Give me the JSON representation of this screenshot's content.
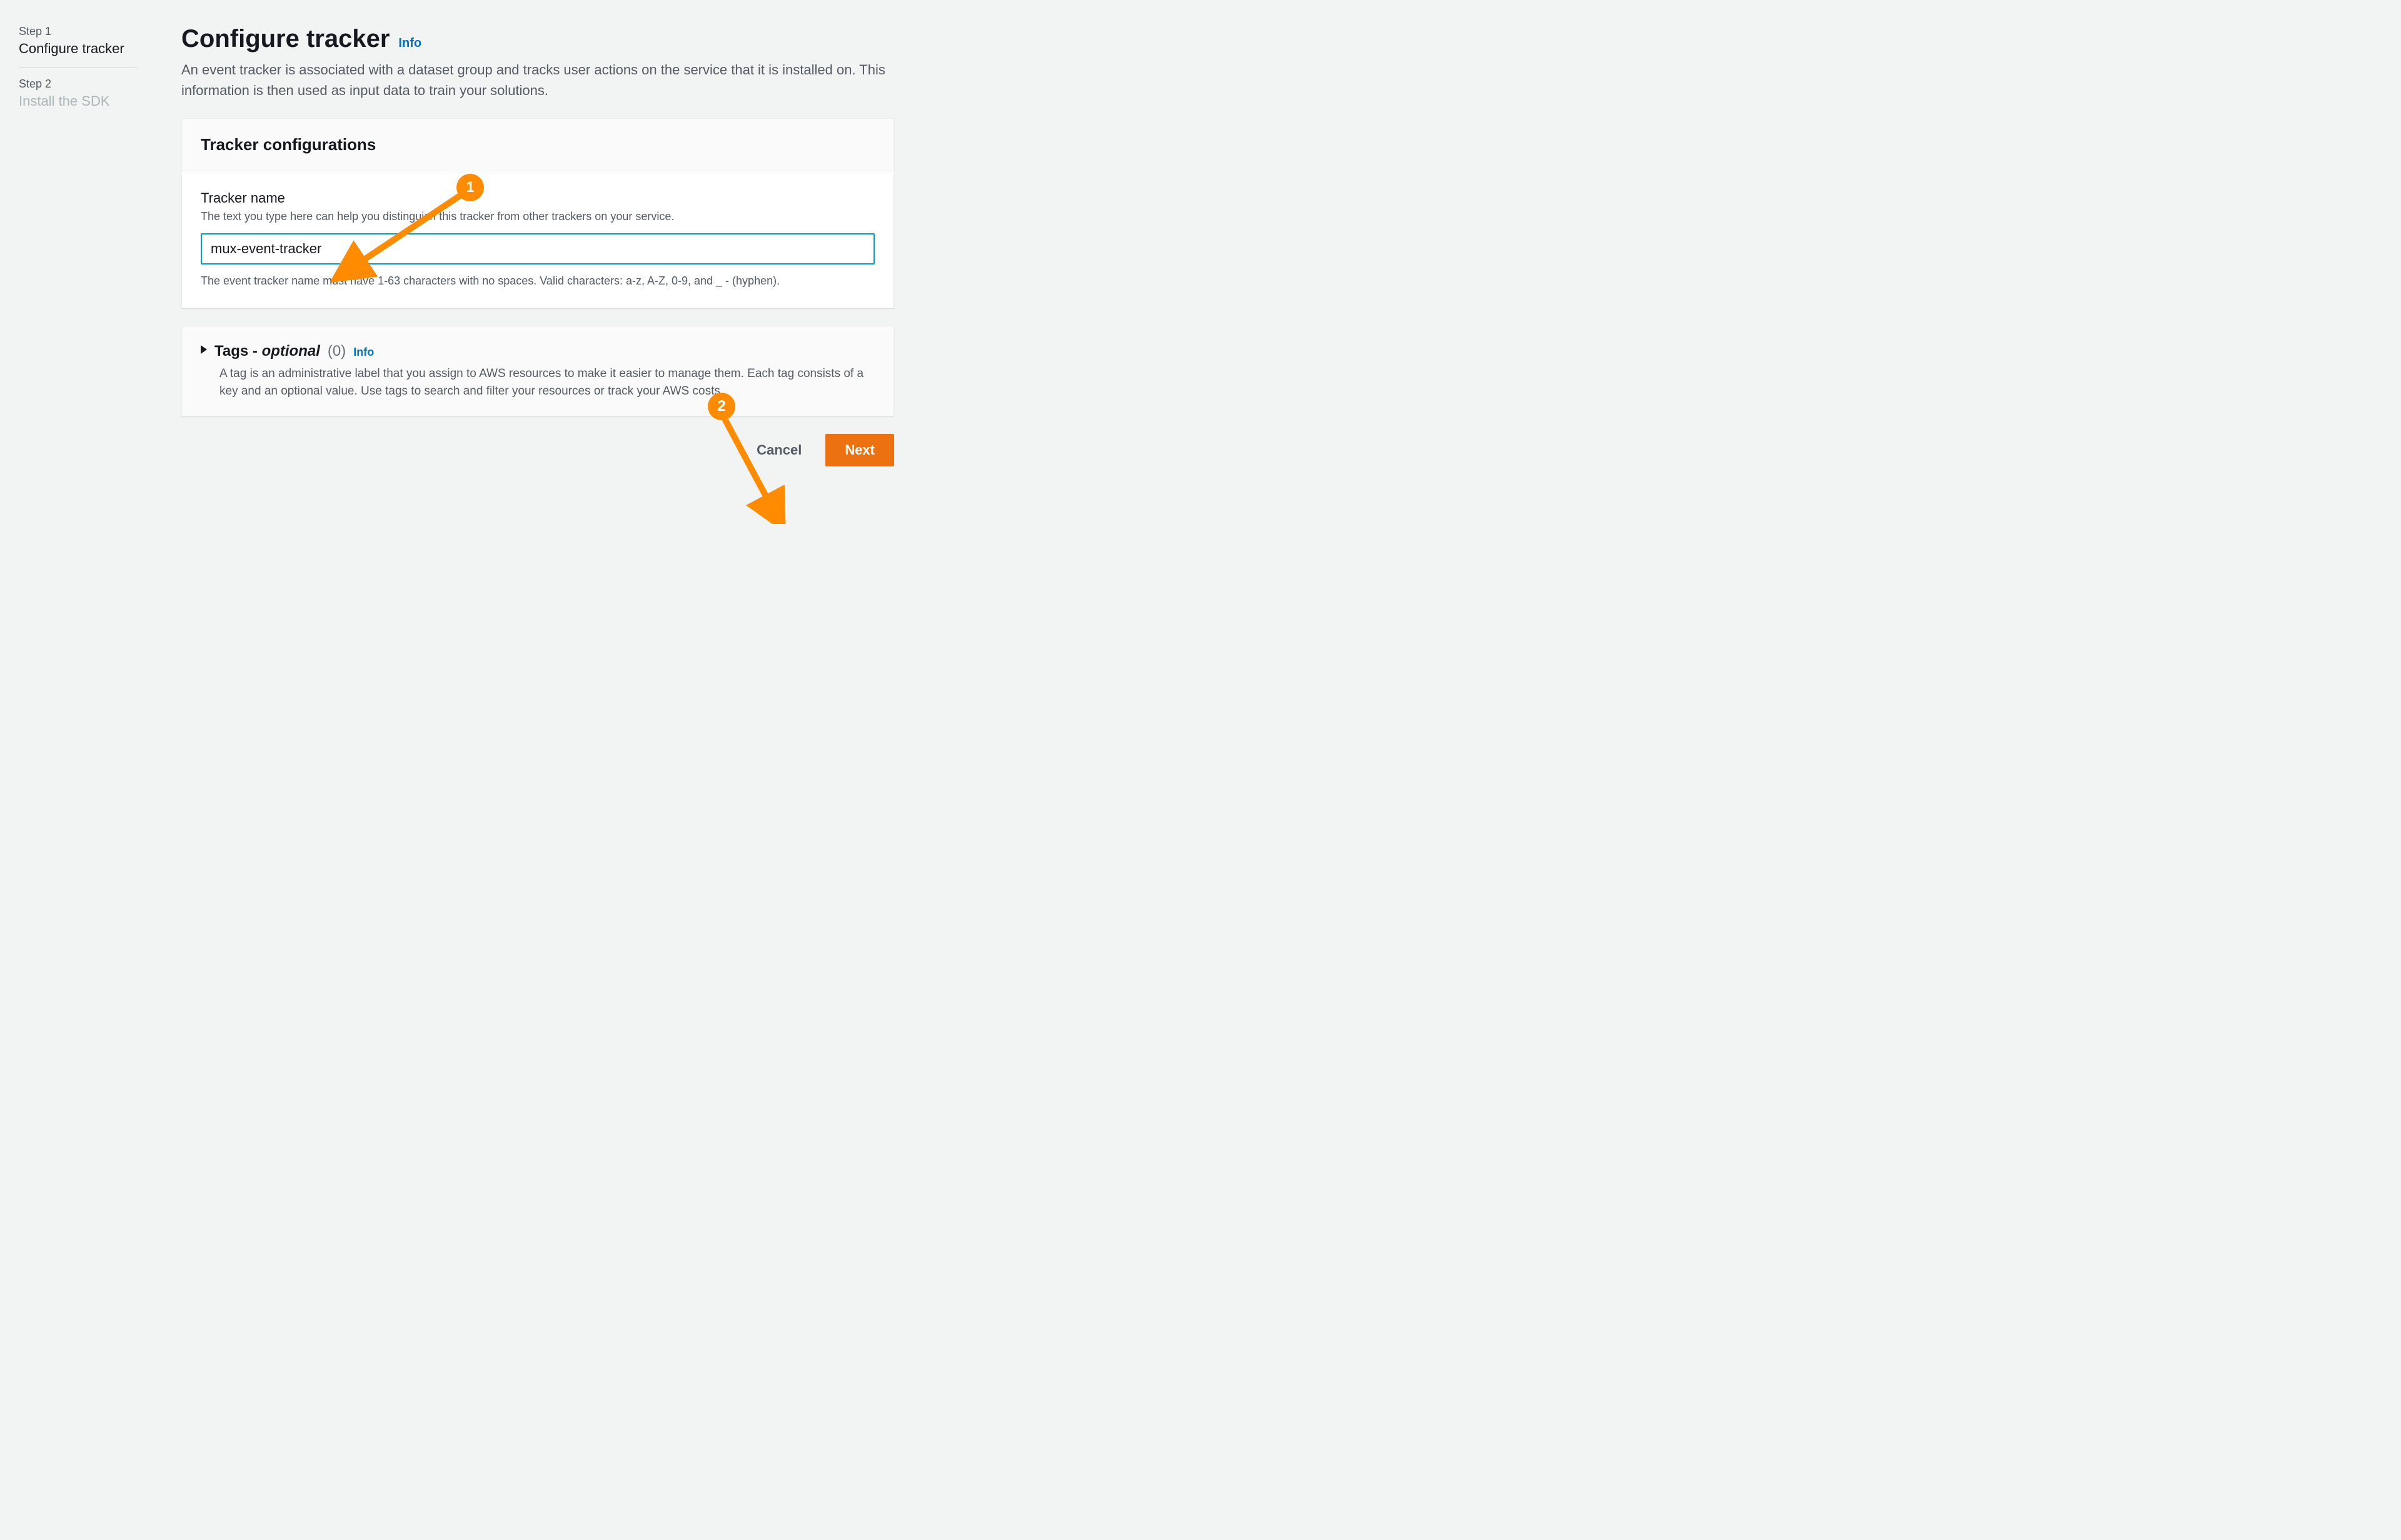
{
  "steps": {
    "items": [
      {
        "number": "Step 1",
        "title": "Configure tracker",
        "active": true
      },
      {
        "number": "Step 2",
        "title": "Install the SDK",
        "active": false
      }
    ]
  },
  "header": {
    "title": "Configure tracker",
    "info": "Info",
    "subtitle": "An event tracker is associated with a dataset group and tracks user actions on the service that it is installed on. This information is then used as input data to train your solutions."
  },
  "panel_config": {
    "title": "Tracker configurations",
    "field_label": "Tracker name",
    "field_help": "The text you type here can help you distinguish this tracker from other trackers on your service.",
    "field_value": "mux-event-tracker",
    "field_constraint": "The event tracker name must have 1-63 characters with no spaces. Valid characters: a-z, A-Z, 0-9, and _ - (hyphen)."
  },
  "panel_tags": {
    "title_prefix": "Tags - ",
    "title_optional": "optional",
    "count": "(0)",
    "info": "Info",
    "description": "A tag is an administrative label that you assign to AWS resources to make it easier to manage them. Each tag consists of a key and an optional value. Use tags to search and filter your resources or track your AWS costs."
  },
  "buttons": {
    "cancel": "Cancel",
    "next": "Next"
  },
  "annotations": {
    "badge1": "1",
    "badge2": "2"
  }
}
